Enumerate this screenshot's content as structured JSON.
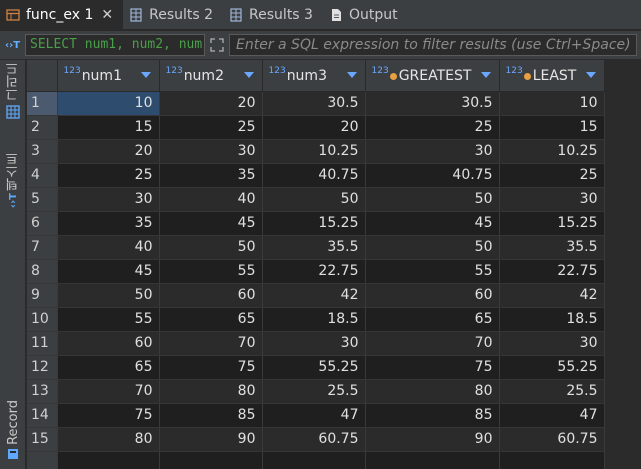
{
  "tabs": [
    {
      "label": "func_ex 1",
      "icon": "table-icon",
      "active": true,
      "closable": true
    },
    {
      "label": "Results 2",
      "icon": "grid-icon",
      "active": false
    },
    {
      "label": "Results 3",
      "icon": "grid-icon",
      "active": false
    },
    {
      "label": "Output",
      "icon": "document-icon",
      "active": false
    }
  ],
  "filter": {
    "sql_preview": "SELECT num1, num2, num",
    "placeholder": "Enter a SQL expression to filter results (use Ctrl+Space)"
  },
  "sidebar": {
    "grid_label": "그리드",
    "text_label": "텍스트",
    "record_label": "Record"
  },
  "grid": {
    "columns": [
      {
        "name": "num1",
        "type_badge": "123"
      },
      {
        "name": "num2",
        "type_badge": "123"
      },
      {
        "name": "num3",
        "type_badge": "123"
      },
      {
        "name": "GREATEST",
        "type_badge": "123"
      },
      {
        "name": "LEAST",
        "type_badge": "123"
      }
    ],
    "rows": [
      [
        "1",
        "10",
        "20",
        "30.5",
        "30.5",
        "10"
      ],
      [
        "2",
        "15",
        "25",
        "20",
        "25",
        "15"
      ],
      [
        "3",
        "20",
        "30",
        "10.25",
        "30",
        "10.25"
      ],
      [
        "4",
        "25",
        "35",
        "40.75",
        "40.75",
        "25"
      ],
      [
        "5",
        "30",
        "40",
        "50",
        "50",
        "30"
      ],
      [
        "6",
        "35",
        "45",
        "15.25",
        "45",
        "15.25"
      ],
      [
        "7",
        "40",
        "50",
        "35.5",
        "50",
        "35.5"
      ],
      [
        "8",
        "45",
        "55",
        "22.75",
        "55",
        "22.75"
      ],
      [
        "9",
        "50",
        "60",
        "42",
        "60",
        "42"
      ],
      [
        "10",
        "55",
        "65",
        "18.5",
        "65",
        "18.5"
      ],
      [
        "11",
        "60",
        "70",
        "30",
        "70",
        "30"
      ],
      [
        "12",
        "65",
        "75",
        "55.25",
        "75",
        "55.25"
      ],
      [
        "13",
        "70",
        "80",
        "25.5",
        "80",
        "25.5"
      ],
      [
        "14",
        "75",
        "85",
        "47",
        "85",
        "47"
      ],
      [
        "15",
        "80",
        "90",
        "60.75",
        "90",
        "60.75"
      ]
    ]
  },
  "colors": {
    "accent": "#6aa8ff",
    "selection": "#2e4d6e",
    "sql_text": "#4a9f4a"
  }
}
